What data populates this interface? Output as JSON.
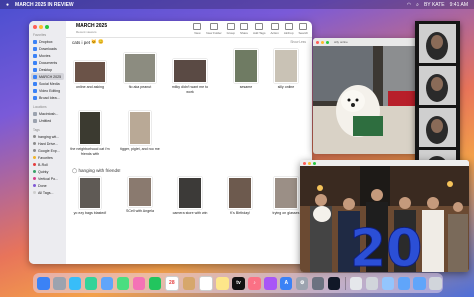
{
  "menubar": {
    "app_name": "MARCH 2025 IN REVIEW",
    "user": "BY KATE",
    "time": "9:41 AM"
  },
  "finder": {
    "title": "MARCH 2025",
    "subtitle": "Recent viewers",
    "toolbar": [
      {
        "label": "View",
        "icon": "grid-view-icon"
      },
      {
        "label": "New Folder",
        "icon": "folder-plus-icon"
      },
      {
        "label": "Group",
        "icon": "group-icon"
      },
      {
        "label": "Share",
        "icon": "share-icon"
      },
      {
        "label": "Add Tags",
        "icon": "tag-icon"
      },
      {
        "label": "Action",
        "icon": "ellipsis-icon"
      },
      {
        "label": "Airdrop",
        "icon": "airdrop-icon"
      },
      {
        "label": "Search",
        "icon": "search-icon"
      }
    ],
    "toolbar_count": "2",
    "path_label": "cats i pet",
    "path_emoji": "🐱 😊",
    "hide_label": "Show Less",
    "section2_label": "hanging with friends!",
    "sidebar": {
      "favorites_heading": "Favorites",
      "favorites": [
        "Dropbox",
        "Downloads",
        "Movies",
        "Documents",
        "Desktop",
        "MARCH 2025",
        "Social Media",
        "Video Editing",
        "Broad Idea..."
      ],
      "selected": "MARCH 2025",
      "locations_heading": "Locations",
      "locations": [
        "Macintosh...",
        "Untitled"
      ],
      "tags_heading": "Tags",
      "tags": [
        {
          "label": "hanging wit...",
          "color": "#8b8b8b"
        },
        {
          "label": "Hard Drive...",
          "color": "#8b8b8b"
        },
        {
          "label": "Google Exp...",
          "color": "#8b8b8b"
        },
        {
          "label": "Favorites",
          "color": "#f0b429"
        },
        {
          "label": "B-Roll",
          "color": "#e53e3e"
        },
        {
          "label": "Quirky",
          "color": "#38a169"
        },
        {
          "label": "Vertical Po...",
          "color": "#d53f8c"
        },
        {
          "label": "Done",
          "color": "#805ad5"
        },
        {
          "label": "All Tags...",
          "color": "#cfcfcf"
        }
      ]
    },
    "files_row1": [
      {
        "name": "online and asking",
        "color": "#6b5348"
      },
      {
        "name": "fio aka peanut",
        "color": "#8c8c80"
      },
      {
        "name": "milky didn't want me to work",
        "color": "#5a4a44"
      },
      {
        "name": "sesame",
        "color": "#6f7b63"
      },
      {
        "name": "silly online",
        "color": "#c9c2b5"
      }
    ],
    "files_row2": [
      {
        "name": "the neighborhood cat i'm friends with",
        "color": "#3b3a30"
      },
      {
        "name": "tigger, piglet, and roo me",
        "color": "#b9a996"
      }
    ],
    "files_row3": [
      {
        "name": "yo ezy bags blasted!",
        "color": "#5f5a55"
      },
      {
        "name": "SCell with Angela",
        "color": "#8a7a6f"
      },
      {
        "name": "camera store with win",
        "color": "#3c3a38"
      },
      {
        "name": "K's Birthday!",
        "color": "#6d5a4e"
      },
      {
        "name": "trying on glasses",
        "color": "#9b8f86"
      }
    ]
  },
  "preview": {
    "title": "silly online"
  },
  "dock": {
    "apps": [
      {
        "name": "finder-icon",
        "color": "#3b82f6",
        "glyph": ""
      },
      {
        "name": "launchpad-icon",
        "color": "#9ca3af",
        "glyph": ""
      },
      {
        "name": "safari-icon",
        "color": "#38bdf8",
        "glyph": ""
      },
      {
        "name": "messages-icon",
        "color": "#34d399",
        "glyph": ""
      },
      {
        "name": "mail-icon",
        "color": "#60a5fa",
        "glyph": ""
      },
      {
        "name": "maps-icon",
        "color": "#4ade80",
        "glyph": ""
      },
      {
        "name": "photos-icon",
        "color": "#f472b6",
        "glyph": ""
      },
      {
        "name": "facetime-icon",
        "color": "#22c55e",
        "glyph": ""
      },
      {
        "name": "calendar-icon",
        "color": "#ffffff",
        "glyph": "28"
      },
      {
        "name": "contacts-icon",
        "color": "#d6a76c",
        "glyph": ""
      },
      {
        "name": "reminders-icon",
        "color": "#ffffff",
        "glyph": ""
      },
      {
        "name": "notes-icon",
        "color": "#fde68a",
        "glyph": ""
      },
      {
        "name": "tv-icon",
        "color": "#111111",
        "glyph": "tv"
      },
      {
        "name": "music-icon",
        "color": "#fb7185",
        "glyph": "♪"
      },
      {
        "name": "podcasts-icon",
        "color": "#a855f7",
        "glyph": ""
      },
      {
        "name": "app-store-icon",
        "color": "#3b82f6",
        "glyph": "A"
      },
      {
        "name": "settings-icon",
        "color": "#9ca3af",
        "glyph": "⚙"
      },
      {
        "name": "iphone-mirroring-icon",
        "color": "#6b7280",
        "glyph": ""
      },
      {
        "name": "final-cut-icon",
        "color": "#111827",
        "glyph": ""
      },
      {
        "name": "script-editor-icon",
        "color": "#e5e7eb",
        "glyph": ""
      },
      {
        "name": "preview-icon",
        "color": "#d1d5db",
        "glyph": ""
      },
      {
        "name": "grapher-icon",
        "color": "#93c5fd",
        "glyph": ""
      },
      {
        "name": "folder-icon",
        "color": "#60a5fa",
        "glyph": ""
      },
      {
        "name": "downloads-icon",
        "color": "#60a5fa",
        "glyph": ""
      },
      {
        "name": "trash-icon",
        "color": "#d1d5db",
        "glyph": ""
      }
    ]
  }
}
